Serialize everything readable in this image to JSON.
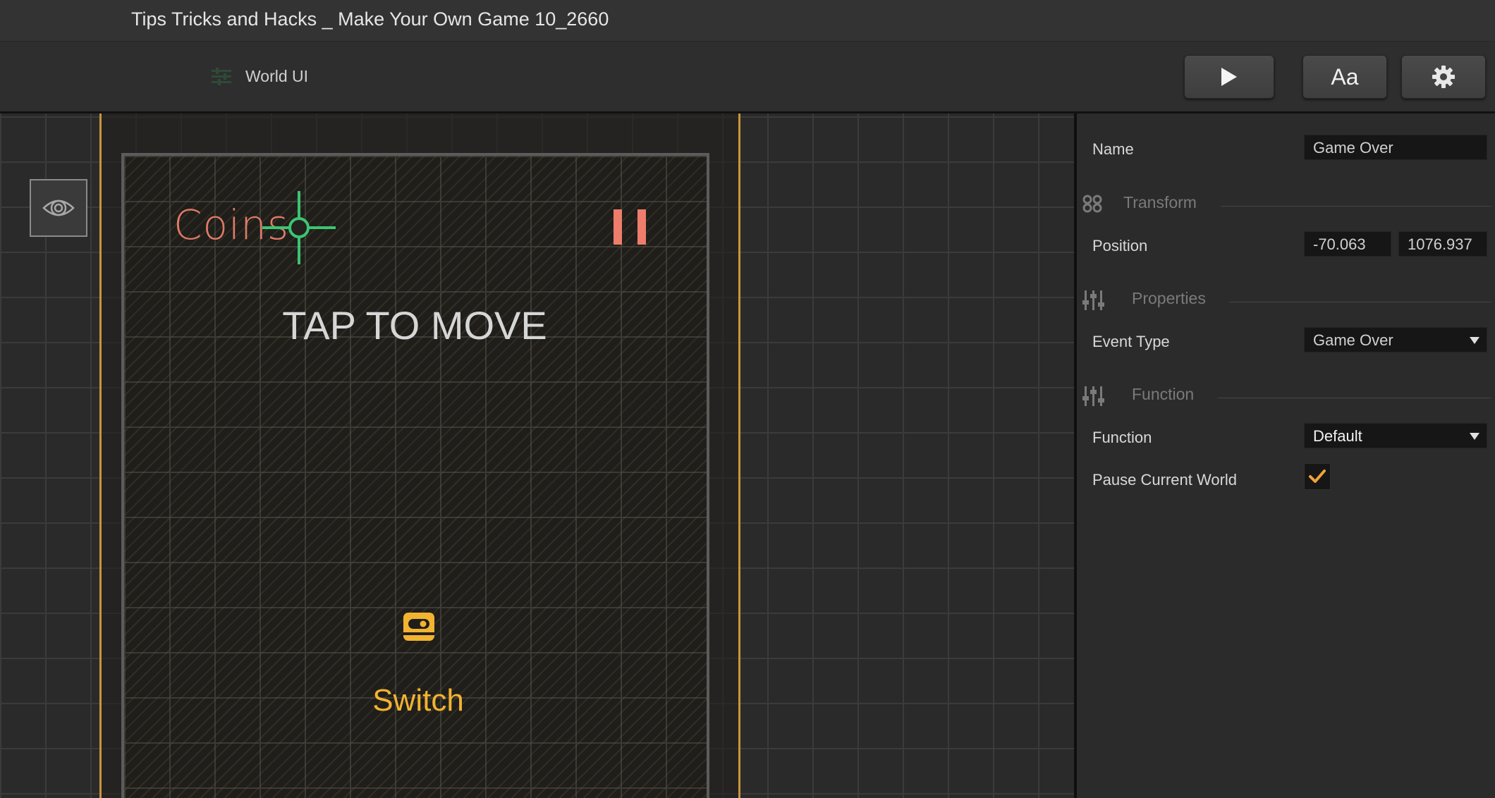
{
  "window": {
    "title": "Tips Tricks and Hacks _ Make Your Own Game 10_2660"
  },
  "toolbar": {
    "breadcrumb_label": "World UI",
    "breadcrumb_icon": "sliders-icon",
    "play_icon": "play-icon",
    "font_label": "Aa",
    "settings_icon": "gear-icon"
  },
  "canvas": {
    "visibility_icon": "eye-icon",
    "coins_text": "Coins",
    "tap_text": "TAP TO MOVE",
    "switch_text": "Switch",
    "colors": {
      "frame": "#c9953a",
      "coins": "#e07b68",
      "crosshair": "#3cc472",
      "pause": "#ef7d6c",
      "switch": "#f2b330"
    }
  },
  "inspector": {
    "name": {
      "label": "Name",
      "value": "Game Over"
    },
    "transform": {
      "title": "Transform",
      "icon": "transform-icon"
    },
    "position": {
      "label": "Position",
      "x": "-70.063",
      "y": "1076.937"
    },
    "properties": {
      "title": "Properties",
      "icon": "sliders-icon"
    },
    "event_type": {
      "label": "Event Type",
      "value": "Game Over"
    },
    "function_section": {
      "title": "Function",
      "icon": "sliders-icon"
    },
    "function": {
      "label": "Function",
      "value": "Default"
    },
    "pause_world": {
      "label": "Pause Current World",
      "checked": true,
      "check_color": "#f2a33a"
    }
  }
}
